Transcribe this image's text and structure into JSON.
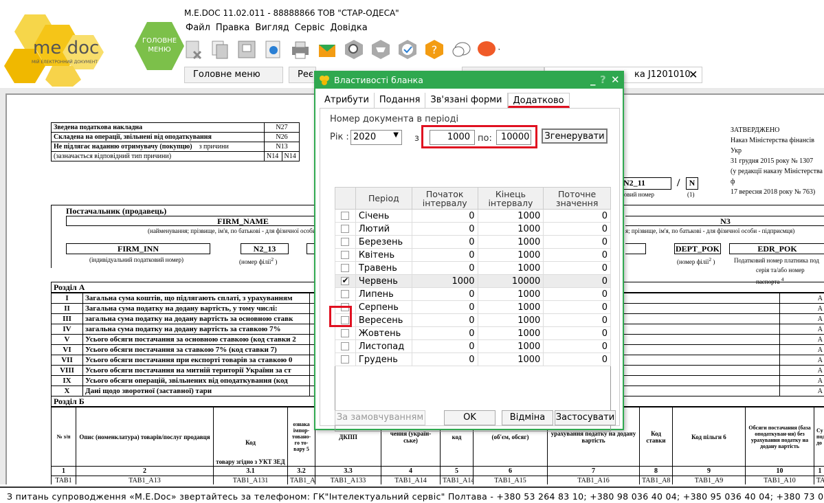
{
  "app": {
    "title": "M.E.DOC 11.02.011 - 88888866 ТОВ \"СТАР-ОДЕСА\"",
    "logo_text": "me doc",
    "logo_sub": "МІЙ ЕЛЕКТРОННИЙ ДОКУМЕНТ",
    "home_label_1": "ГОЛОВНЕ",
    "home_label_2": "МЕНЮ"
  },
  "menu": [
    "Файл",
    "Правка",
    "Вигляд",
    "Сервіс",
    "Довідка"
  ],
  "tabs": {
    "t1": "Головне меню",
    "t2": "Реє",
    "t3": "ка J1201010",
    "close": "✕"
  },
  "doc": {
    "top_rows": [
      "Зведена податкова накладна",
      "Складена на операції, звільнені від оподаткування",
      "Не підлягає наданню отримувачу (покупцю)",
      "(зазначається відповідний тип причини)"
    ],
    "top_codes": [
      "N27",
      "N26",
      "N13",
      "N14",
      "N14"
    ],
    "reason": "з причини",
    "approved": [
      "ЗАТВЕРДЖЕНО",
      "Наказ Міністерства фінансів  Укр",
      "31 грудня 2015 року № 1307",
      "(у редакції наказу Міністерства ф",
      "17 вересня 2018 року № 763)"
    ],
    "n2_11": "N2_11",
    "slash": "/",
    "n_box": "N",
    "nomer": "овий номер",
    "one": "(1)",
    "supplier": "Постачальник (продавець)",
    "firm_name": "FIRM_NAME",
    "firm_name_note": "(найменування; прізвище, ім'я, по батькові - для фізичної особи",
    "n3": "N3",
    "n3_note": "я; прізвище, ім'я, по батькові - для фізичної особи - підприємця)",
    "firm_inn": "FIRM_INN",
    "inn_note": "(індивідуальний податковий номер)",
    "n2_13": "N2_13",
    "branch_note": "(номер філії",
    "dept_pok": "DEPT_POK",
    "dept_note": "(номер філії",
    "edr_pok": "EDR_POK",
    "edr_note1": "Податковий номер платника под",
    "edr_note2": "серія та/або номер паспорта",
    "section_a": "Розділ А",
    "rows_a": [
      [
        "I",
        "Загальна сума коштів, що підлягають сплаті, з урахуванням"
      ],
      [
        "II",
        "Загальна сума податку на додану вартість, у тому числі:"
      ],
      [
        "III",
        "загальна сума податку на додану вартість за основною ставк"
      ],
      [
        "IV",
        "загальна сума податку на додану вартість за ставкою 7%"
      ],
      [
        "V",
        "Усього обсяги постачання за основною ставкою (код ставки 2"
      ],
      [
        "VI",
        "Усього обсяги постачання за ставкою 7% (код ставки 7)"
      ],
      [
        "VII",
        "Усього обсяги постачання при експорті товарів за ставкою 0"
      ],
      [
        "VIII",
        "Усього обсяги постачання на митній території України за ст"
      ],
      [
        "IX",
        "Усього обсяги операцій, звільнених від оподаткування (код"
      ],
      [
        "X",
        "Дані щодо зворотної (заставної) тари"
      ]
    ],
    "section_b": "Розділ Б",
    "hdr_b": {
      "num": "№ з/п",
      "desc": "Опис (номенклатура) товарів/послуг продавця",
      "code": "Код",
      "ukt": "товару згідно з УКТ ЗЕД",
      "imp": "ознака імпор-товано-го то-вару 5",
      "dkpp": "ДКПП",
      "unit": "чення (україн-ське)",
      "kod": "код",
      "vol": "(об'єм, обсяг)",
      "price": "урахування податку на додану вартість",
      "rate": "Код ставки",
      "benefit": "Код пільги 6",
      "supply": "Обсяги постачання (база оподаткуван-ня) без урахування податку на додану вартість",
      "su": "Су пода до"
    },
    "nums_b": [
      "1",
      "2",
      "3.1",
      "3.2",
      "3.3",
      "4",
      "5",
      "6",
      "7",
      "8",
      "9",
      "10",
      "1"
    ],
    "row_b": [
      "TAB1",
      "TAB1_A13",
      "TAB1_A131",
      "TAB1_A",
      "TAB1_A133",
      "TAB1_A14",
      "TAB1_A14",
      "TAB1_A15",
      "TAB1_A16",
      "TAB1_A8",
      "TAB1_A9",
      "TAB1_A10",
      "TAB1"
    ],
    "a_col": "A"
  },
  "status": "З питань супроводження «M.E.Doc» звертайтесь за телефоном: ГК\"Інтелектуальний сервіс\" Полтава - +380 53 264 83 10; +380 98 036 40 04; +380 95 036 40 04; +380 73 036 40 04",
  "dialog": {
    "title": "Властивості бланка",
    "tabs": [
      "Атрибути",
      "Подання",
      "Зв'язані форми",
      "Додатково"
    ],
    "group_label": "Номер документа в періоді",
    "year_label": "Рік :",
    "year": "2020",
    "from_label": "з",
    "from": "1000",
    "to_label": "по:",
    "to": "10000",
    "generate": "Згенерувати",
    "columns": [
      "Період",
      "Початок інтервалу",
      "Кінець інтервалу",
      "Поточне значення"
    ],
    "rows": [
      {
        "checked": false,
        "month": "Січень",
        "start": "0",
        "end": "1000",
        "cur": "0"
      },
      {
        "checked": false,
        "month": "Лютий",
        "start": "0",
        "end": "1000",
        "cur": "0"
      },
      {
        "checked": false,
        "month": "Березень",
        "start": "0",
        "end": "1000",
        "cur": "0"
      },
      {
        "checked": false,
        "month": "Квітень",
        "start": "0",
        "end": "1000",
        "cur": "0"
      },
      {
        "checked": false,
        "month": "Травень",
        "start": "0",
        "end": "1000",
        "cur": "0"
      },
      {
        "checked": true,
        "month": "Червень",
        "start": "1000",
        "end": "10000",
        "cur": "0"
      },
      {
        "checked": false,
        "month": "Липень",
        "start": "0",
        "end": "1000",
        "cur": "0"
      },
      {
        "checked": false,
        "month": "Серпень",
        "start": "0",
        "end": "1000",
        "cur": "0"
      },
      {
        "checked": false,
        "month": "Вересень",
        "start": "0",
        "end": "1000",
        "cur": "0"
      },
      {
        "checked": false,
        "month": "Жовтень",
        "start": "0",
        "end": "1000",
        "cur": "0"
      },
      {
        "checked": false,
        "month": "Листопад",
        "start": "0",
        "end": "1000",
        "cur": "0"
      },
      {
        "checked": false,
        "month": "Грудень",
        "start": "0",
        "end": "1000",
        "cur": "0"
      }
    ],
    "default_btn": "За замовчуванням",
    "ok": "OK",
    "cancel": "Відміна",
    "apply": "Застосувати",
    "minimize": "_",
    "help": "?",
    "close": "✕"
  },
  "colors": {
    "accent_green": "#2fa84f",
    "highlight_red": "#e01020",
    "logo_yellow": "#f5c518"
  }
}
